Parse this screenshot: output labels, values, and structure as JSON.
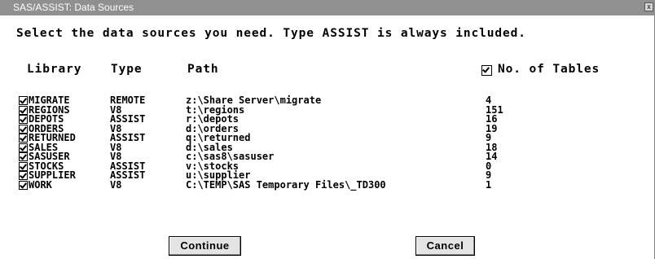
{
  "window": {
    "title": "SAS/ASSIST: Data Sources",
    "close_symbol": "x"
  },
  "instruction": "Select the data sources you need. Type ASSIST is always included.",
  "headers": {
    "library": "Library",
    "type": "Type",
    "path": "Path",
    "no_of_tables": "No. of Tables",
    "no_of_tables_checked": true
  },
  "rows": [
    {
      "library": "MIGRATE",
      "type": "REMOTE",
      "path": "z:\\Share Server\\migrate",
      "tables": "4",
      "checked": true
    },
    {
      "library": "REGIONS",
      "type": "V8",
      "path": "t:\\regions",
      "tables": "151",
      "checked": true
    },
    {
      "library": "DEPOTS",
      "type": "ASSIST",
      "path": "r:\\depots",
      "tables": "16",
      "checked": true
    },
    {
      "library": "ORDERS",
      "type": "V8",
      "path": "d:\\orders",
      "tables": "19",
      "checked": true
    },
    {
      "library": "RETURNED",
      "type": "ASSIST",
      "path": "q:\\returned",
      "tables": "9",
      "checked": true
    },
    {
      "library": "SALES",
      "type": "V8",
      "path": "d:\\sales",
      "tables": "18",
      "checked": true
    },
    {
      "library": "SASUSER",
      "type": "V8",
      "path": "c:\\sas8\\sasuser",
      "tables": "14",
      "checked": true
    },
    {
      "library": "STOCKS",
      "type": "ASSIST",
      "path": "v:\\stocks",
      "tables": "0",
      "checked": true
    },
    {
      "library": "SUPPLIER",
      "type": "ASSIST",
      "path": "u:\\supplier",
      "tables": "9",
      "checked": true
    },
    {
      "library": "WORK",
      "type": "V8",
      "path": "C:\\TEMP\\SAS Temporary Files\\_TD300",
      "tables": "1",
      "checked": true
    }
  ],
  "buttons": {
    "continue": "Continue",
    "cancel": "Cancel"
  }
}
